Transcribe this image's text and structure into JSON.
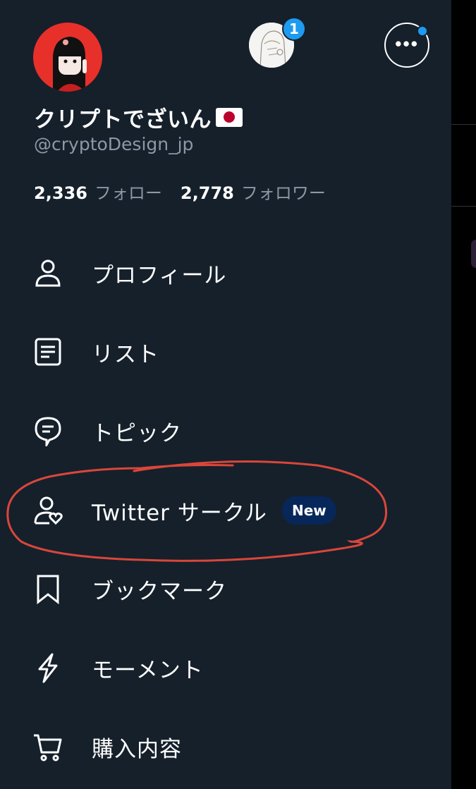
{
  "profile": {
    "display_name": "クリプトでざいん",
    "handle": "@cryptoDesign_jp",
    "following_count": "2,336",
    "following_label": "フォロー",
    "followers_count": "2,778",
    "followers_label": "フォロワー"
  },
  "account_switcher": {
    "notification_count": "1"
  },
  "menu": {
    "items": [
      {
        "label": "プロフィール",
        "icon": "person-icon"
      },
      {
        "label": "リスト",
        "icon": "list-icon"
      },
      {
        "label": "トピック",
        "icon": "topic-icon"
      },
      {
        "label": "Twitter サークル",
        "icon": "circle-icon",
        "badge": "New"
      },
      {
        "label": "ブックマーク",
        "icon": "bookmark-icon"
      },
      {
        "label": "モーメント",
        "icon": "lightning-icon"
      },
      {
        "label": "購入内容",
        "icon": "cart-icon"
      }
    ]
  },
  "colors": {
    "background": "#15202b",
    "accent": "#1d9bf0",
    "secondary_text": "#8b98a5",
    "annotation": "#d9463a",
    "badge_bg": "#07275a"
  }
}
